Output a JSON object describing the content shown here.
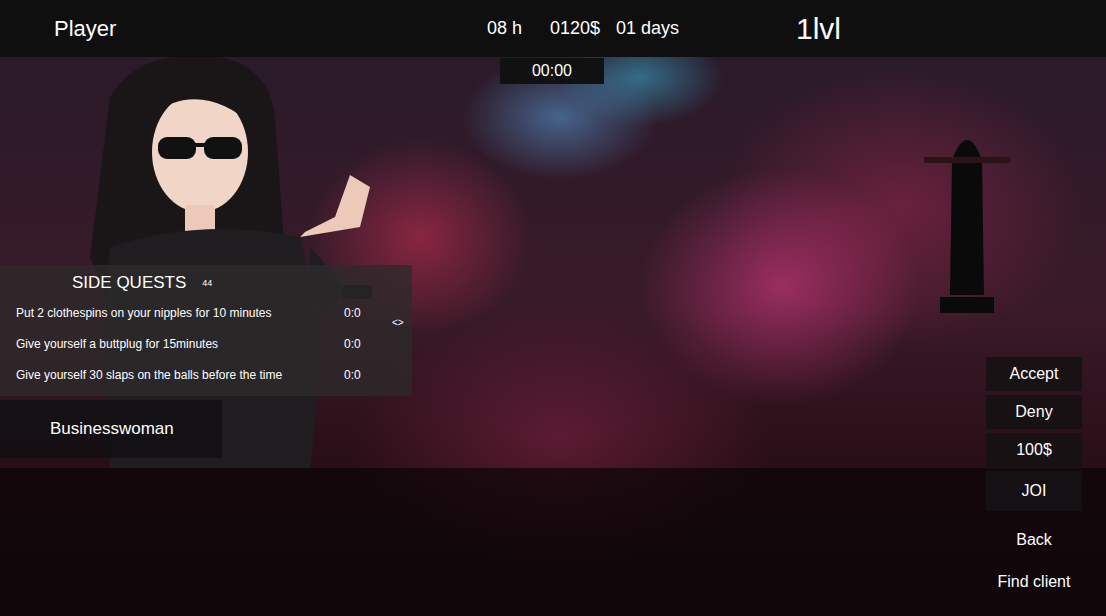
{
  "top_bar": {
    "player": "Player",
    "hours": "08 h",
    "money": "0120$",
    "days": "01 days",
    "level": "1lvl"
  },
  "timer": "00:00",
  "side_quests": {
    "title": "SIDE QUESTS",
    "count": "44",
    "toggle": "<>",
    "items": [
      {
        "text": "Put 2 clothespins on your nipples for 10 minutes",
        "time": "0:0"
      },
      {
        "text": "Give yourself a buttplug for 15minutes",
        "time": "0:0"
      },
      {
        "text": "Give yourself 30 slaps on the balls before the time",
        "time": "0:0"
      }
    ]
  },
  "client": {
    "type": "Businesswoman"
  },
  "actions": [
    "Accept",
    "Deny",
    "100$",
    "JOI",
    "Back",
    "Find client"
  ]
}
